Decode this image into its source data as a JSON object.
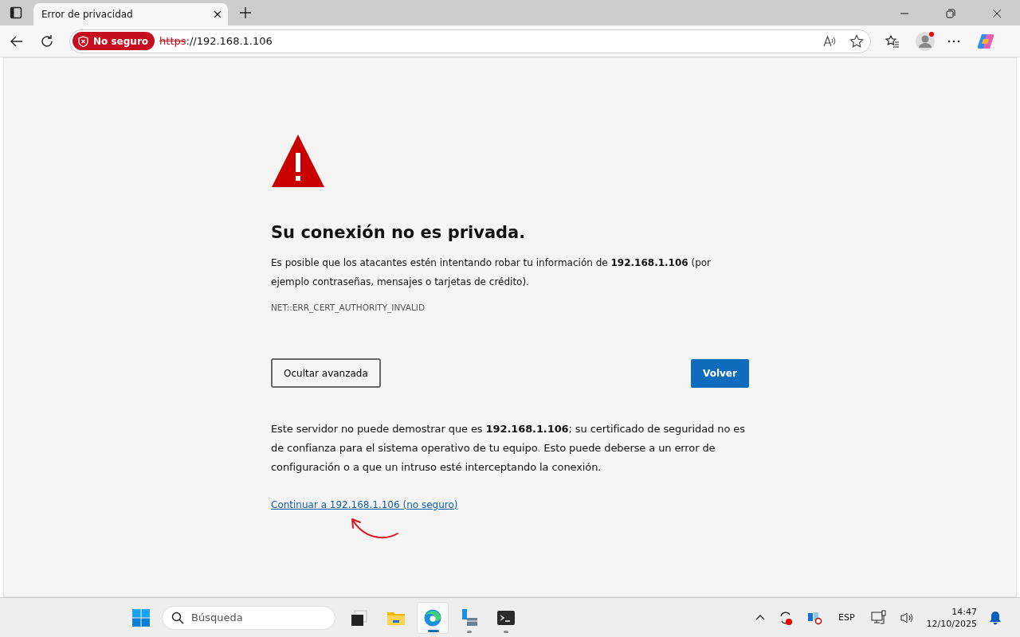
{
  "tabs": [
    {
      "title": "Error de privacidad",
      "selected": true
    }
  ],
  "address_bar": {
    "security_label": "No seguro",
    "scheme": "https",
    "rest": "://192.168.1.106"
  },
  "page": {
    "heading": "Su conexión no es privada.",
    "intro": "Es posible que los atacantes estén intentando robar tu información de **192.168.1.106** (por ejemplo contraseñas, mensajes o tarjetas de crédito).",
    "error_code": "NET::ERR_CERT_AUTHORITY_INVALID",
    "buttons": [
      {
        "label": "Ocultar avanzada",
        "kind": "secondary"
      },
      {
        "label": "Volver",
        "kind": "primary"
      }
    ],
    "details": "Este servidor no puede demostrar que es **192.168.1.106**; su certificado de seguridad no es de confianza para el sistema operativo de tu equipo. Esto puede deberse a un error de configuración o a que un intruso esté interceptando la conexión.",
    "proceed_link": "Continuar a 192.168.1.106 (no seguro)"
  },
  "taskbar": {
    "search_placeholder": "Búsqueda",
    "apps": [
      {
        "kind": "taskview",
        "selected": false,
        "running": false
      },
      {
        "kind": "folder",
        "selected": false,
        "running": false
      },
      {
        "kind": "browser",
        "selected": true,
        "running": true
      },
      {
        "kind": "network",
        "selected": false,
        "running": true
      },
      {
        "kind": "terminal",
        "selected": false,
        "running": true
      }
    ],
    "language": "ESP",
    "time": "14:47",
    "date": "12/10/2025"
  }
}
